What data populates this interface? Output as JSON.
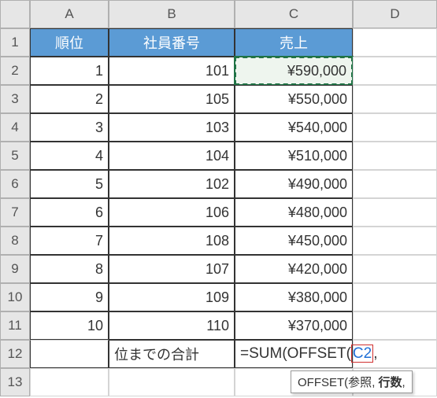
{
  "columns": [
    "A",
    "B",
    "C",
    "D"
  ],
  "rows": [
    "1",
    "2",
    "3",
    "4",
    "5",
    "6",
    "7",
    "8",
    "9",
    "10",
    "11",
    "12",
    "13"
  ],
  "headers": {
    "A": "順位",
    "B": "社員番号",
    "C": "売上"
  },
  "chart_data": {
    "type": "table",
    "title": "売上",
    "columns": [
      "順位",
      "社員番号",
      "売上"
    ],
    "rows": [
      {
        "順位": 1,
        "社員番号": 101,
        "売上": 590000
      },
      {
        "順位": 2,
        "社員番号": 105,
        "売上": 550000
      },
      {
        "順位": 3,
        "社員番号": 103,
        "売上": 540000
      },
      {
        "順位": 4,
        "社員番号": 104,
        "売上": 510000
      },
      {
        "順位": 5,
        "社員番号": 102,
        "売上": 490000
      },
      {
        "順位": 6,
        "社員番号": 106,
        "売上": 480000
      },
      {
        "順位": 7,
        "社員番号": 108,
        "売上": 450000
      },
      {
        "順位": 8,
        "社員番号": 107,
        "売上": 420000
      },
      {
        "順位": 9,
        "社員番号": 109,
        "売上": 380000
      },
      {
        "順位": 10,
        "社員番号": 110,
        "売上": 370000
      }
    ]
  },
  "display": {
    "A": [
      "1",
      "2",
      "3",
      "4",
      "5",
      "6",
      "7",
      "8",
      "9",
      "10"
    ],
    "B": [
      "101",
      "105",
      "103",
      "104",
      "102",
      "106",
      "108",
      "107",
      "109",
      "110"
    ],
    "C": [
      "¥590,000",
      "¥550,000",
      "¥540,000",
      "¥510,000",
      "¥490,000",
      "¥480,000",
      "¥450,000",
      "¥420,000",
      "¥380,000",
      "¥370,000"
    ]
  },
  "row12": {
    "B": "位までの合計",
    "formula_prefix": "=SUM(OFFSET(",
    "formula_ref": "C2",
    "formula_suffix": ","
  },
  "tooltip": {
    "fn": "OFFSET(",
    "arg1": "参照",
    "sep": ", ",
    "arg_bold": "行数",
    "suffix": ","
  },
  "active_cell": "C2"
}
